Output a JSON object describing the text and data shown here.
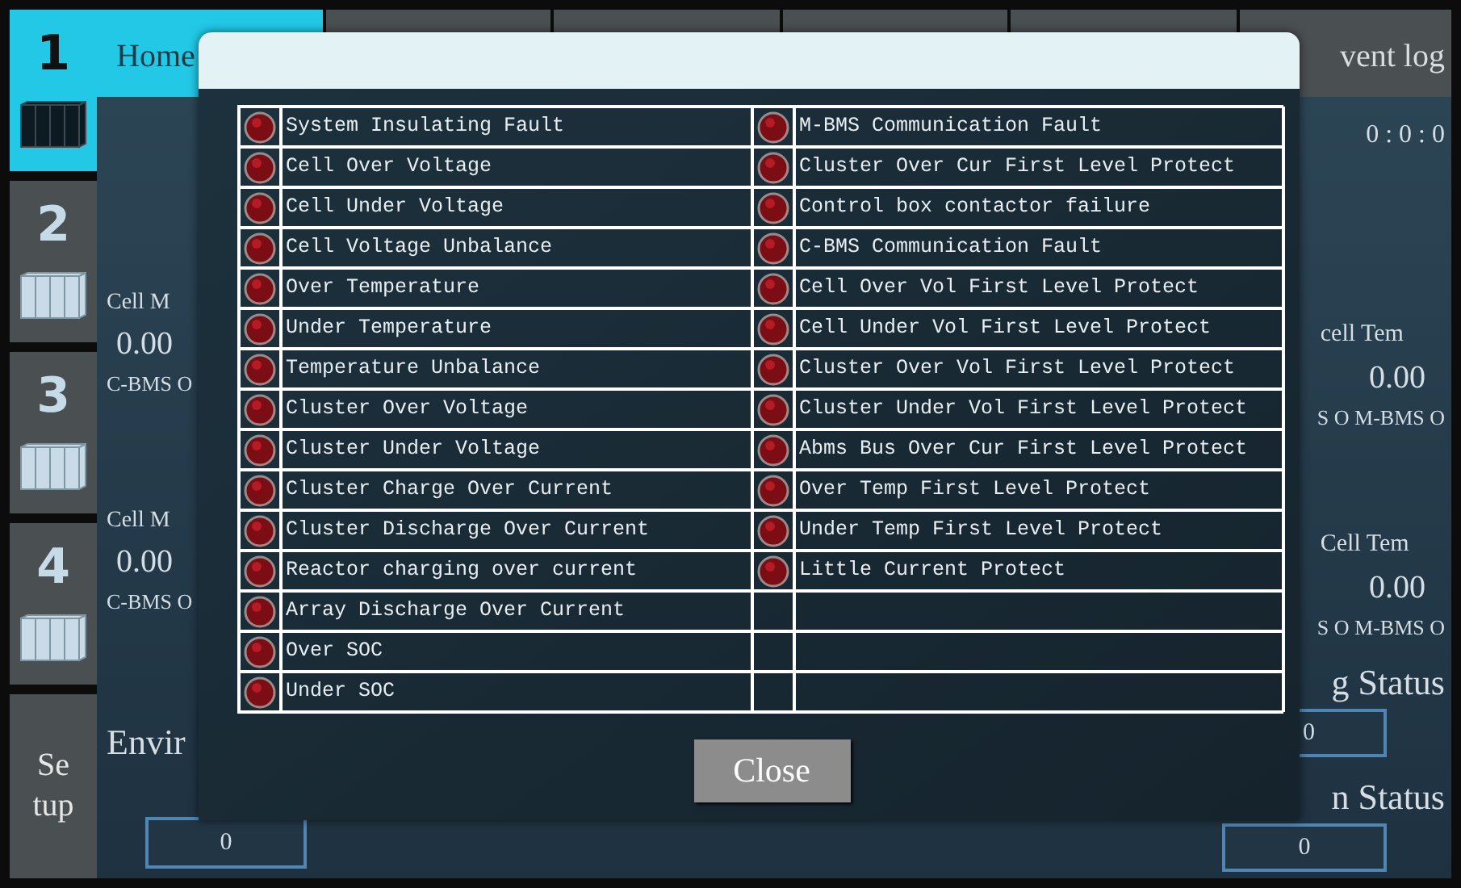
{
  "sidebar": {
    "items": [
      {
        "label": "1",
        "selected": true,
        "kind": "rack"
      },
      {
        "label": "2",
        "selected": false,
        "kind": "rack"
      },
      {
        "label": "3",
        "selected": false,
        "kind": "rack"
      },
      {
        "label": "4",
        "selected": false,
        "kind": "rack"
      },
      {
        "label": "Se tup",
        "selected": false,
        "kind": "text"
      }
    ]
  },
  "tabs": [
    {
      "label": "Home",
      "selected": true
    },
    {
      "selected": false
    },
    {
      "selected": false
    },
    {
      "selected": false
    },
    {
      "selected": false
    },
    {
      "label": "vent log",
      "selected": false
    }
  ],
  "left_panel": {
    "groups": [
      {
        "label": "Cell M",
        "value": "0.00",
        "status": "C-BMS O"
      },
      {
        "label": "Cell M",
        "value": "0.00",
        "status": "C-BMS O"
      }
    ],
    "env_label": "Envir",
    "env_value": "0"
  },
  "right_panel": {
    "time": "0 : 0 : 0",
    "groups": [
      {
        "label": "cell Tem",
        "value": "0.00",
        "status": "S O M-BMS O"
      },
      {
        "label": "Cell Tem",
        "value": "0.00",
        "status": "S O M-BMS O"
      }
    ],
    "statuses": [
      {
        "label": "g Status",
        "value": "0"
      },
      {
        "label": "n Status",
        "value": "0"
      }
    ]
  },
  "dialog": {
    "alarms_left": [
      "System Insulating Fault",
      "Cell Over Voltage",
      "Cell Under Voltage",
      "Cell Voltage Unbalance",
      "Over Temperature",
      "Under Temperature",
      "Temperature Unbalance",
      "Cluster Over Voltage",
      "Cluster Under Voltage",
      "Cluster Charge Over Current",
      "Cluster Discharge Over Current",
      "Reactor charging over current",
      "Array Discharge Over Current",
      "Over SOC",
      "Under SOC"
    ],
    "alarms_right": [
      "M-BMS Communication Fault",
      "Cluster Over Cur First Level Protect",
      "Control box contactor failure",
      "C-BMS Communication Fault",
      "Cell Over Vol First Level Protect",
      "Cell Under Vol First Level Protect",
      "Cluster Over Vol First Level Protect",
      "Cluster Under Vol First Level Protect",
      "Abms Bus Over Cur First Level Protect",
      "Over Temp First Level Protect",
      "Under Temp First Level Protect",
      "Little Current Protect"
    ],
    "close_button": "Close"
  }
}
